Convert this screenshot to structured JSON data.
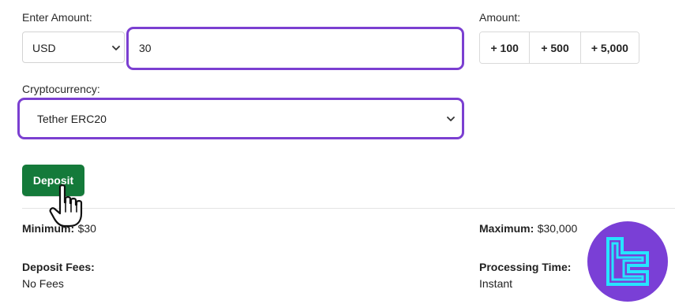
{
  "amount_section": {
    "label": "Enter Amount:",
    "currency": "USD",
    "value": "30"
  },
  "quick_amounts": {
    "label": "Amount:",
    "options": [
      "+ 100",
      "+ 500",
      "+ 5,000"
    ]
  },
  "crypto_section": {
    "label": "Cryptocurrency:",
    "selected": "Tether ERC20"
  },
  "deposit_button": {
    "label": "Deposit"
  },
  "limits": {
    "minimum_label": "Minimum:",
    "minimum_value": "$30",
    "maximum_label": "Maximum:",
    "maximum_value": "$30,000"
  },
  "fees": {
    "label": "Deposit Fees:",
    "value": "No Fees"
  },
  "processing": {
    "label": "Processing Time:",
    "value": "Instant"
  },
  "colors": {
    "focus_ring": "#7b3fd1",
    "deposit_button": "#147a3a",
    "logo_background": "#7a3fd6",
    "logo_mark": "#27e4ff"
  },
  "icons": [
    "chevron-down-icon",
    "hand-cursor-icon",
    "brand-logo-icon"
  ]
}
